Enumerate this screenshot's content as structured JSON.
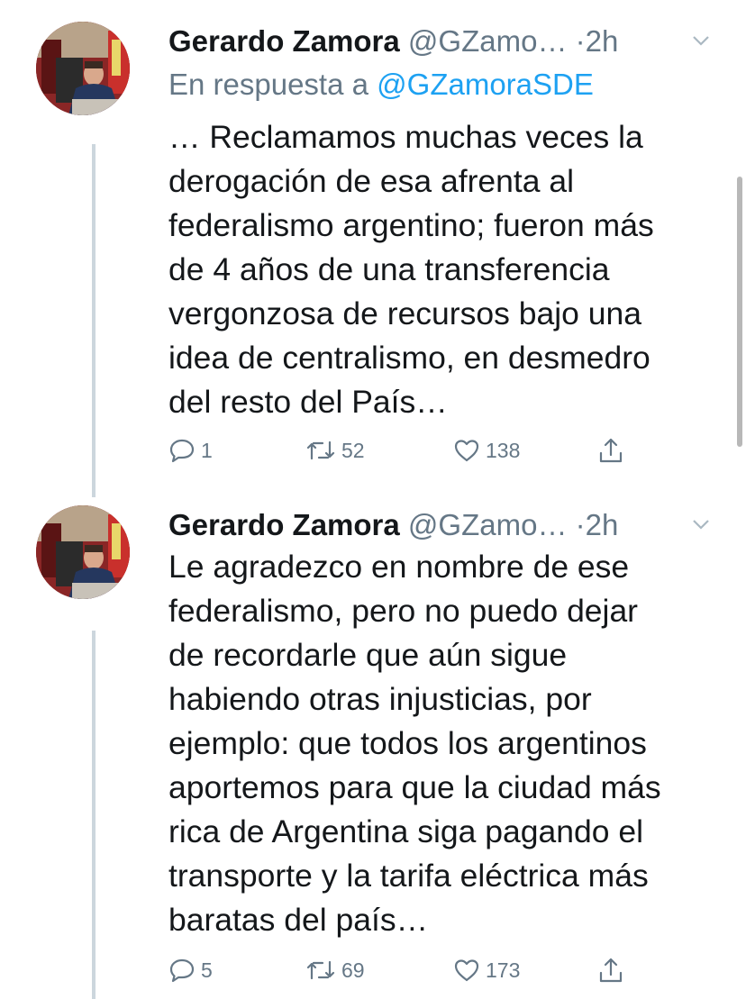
{
  "tweets": [
    {
      "author_name": "Gerardo Zamora",
      "handle": "@GZamo…",
      "dot": "·",
      "time": "2h",
      "reply_prefix": "En respuesta a",
      "reply_to": "@GZamoraSDE",
      "lines": [
        "… Reclamamos muchas veces la",
        "derogación de esa afrenta al",
        "federalismo argentino; fueron más",
        "de 4 años de una transferencia",
        "vergonzosa de recursos bajo una",
        "idea de centralismo, en desmedro",
        "del resto del País…"
      ],
      "replies": "1",
      "retweets": "52",
      "likes": "138"
    },
    {
      "author_name": "Gerardo Zamora",
      "handle": "@GZamo…",
      "dot": "·",
      "time": "2h",
      "lines": [
        "Le agradezco en nombre de ese",
        "federalismo, pero no puedo dejar",
        "de recordarle que aún sigue",
        "habiendo otras injusticias, por",
        "ejemplo: que todos los argentinos",
        "aportemos para que la ciudad más",
        "rica de Argentina siga pagando el",
        "transporte y la tarifa eléctrica más",
        "baratas del país…"
      ],
      "replies": "5",
      "retweets": "69",
      "likes": "173"
    }
  ],
  "icons": {
    "reply": "reply-icon",
    "retweet": "retweet-icon",
    "like": "like-icon",
    "share": "share-icon",
    "caret": "chevron-down-icon"
  },
  "colors": {
    "text": "#14171a",
    "secondary": "#657786",
    "link": "#1da1f2",
    "thread_line": "#ccd6dd"
  }
}
